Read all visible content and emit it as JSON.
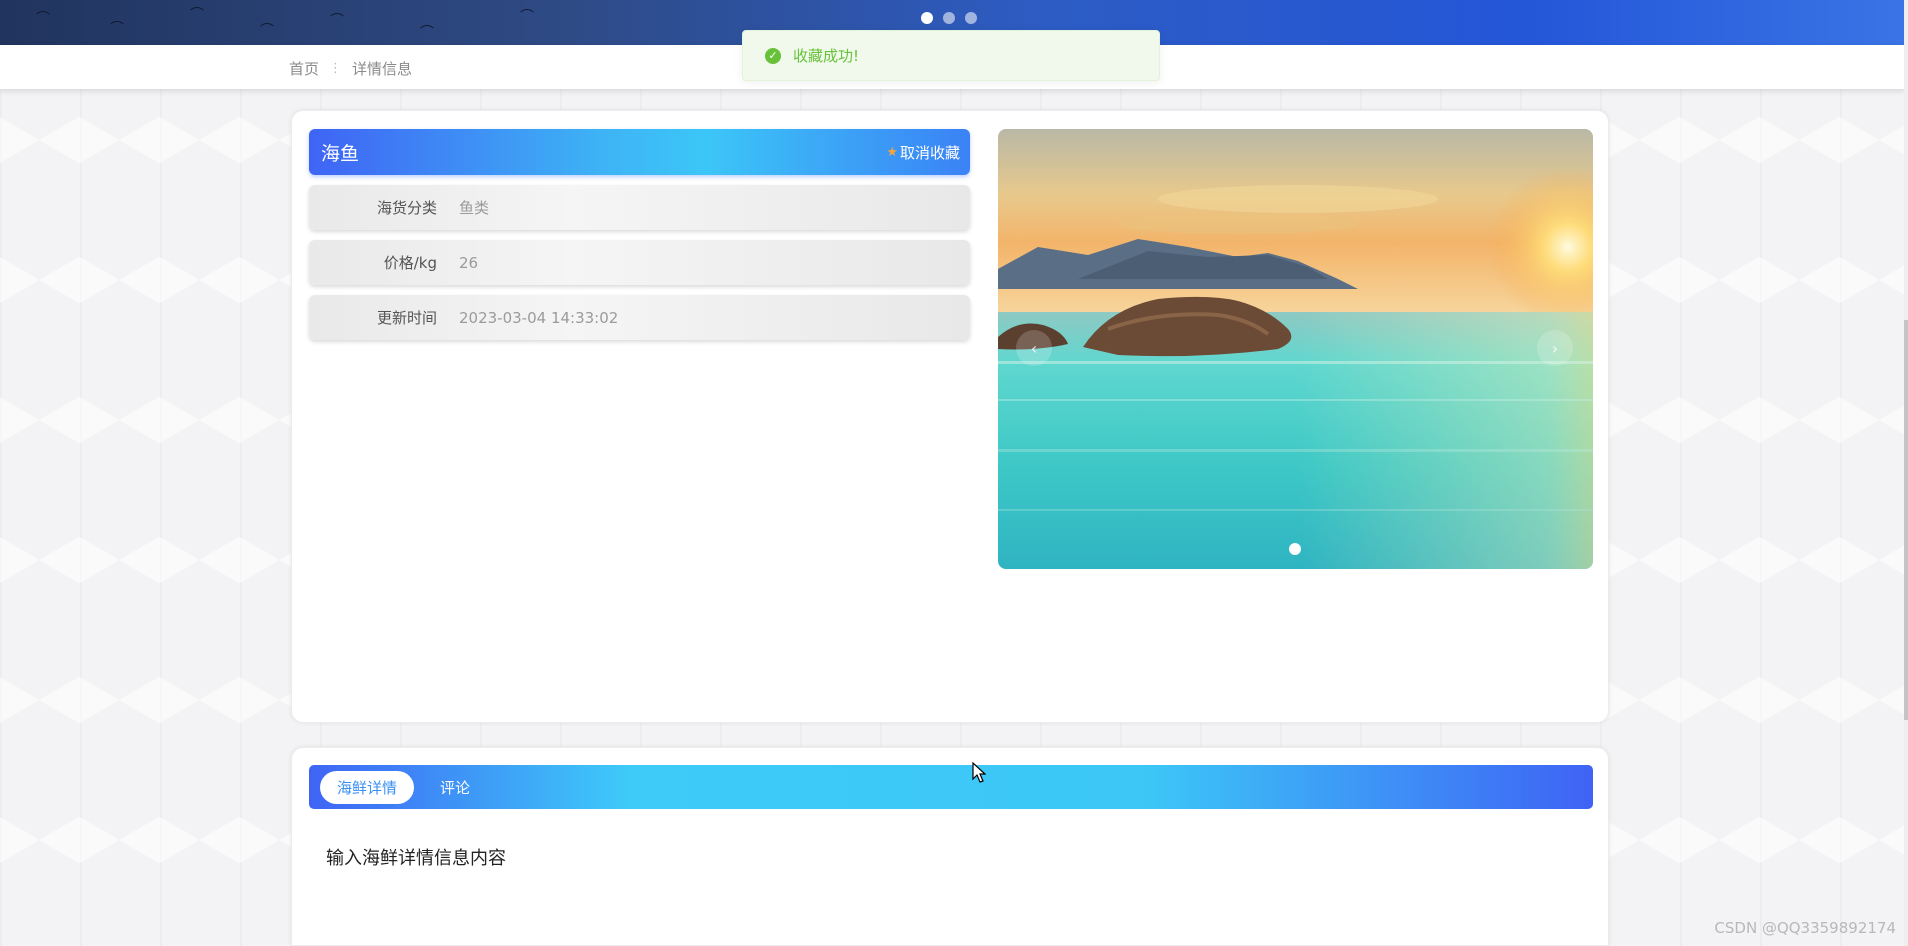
{
  "banner": {
    "slides": 3,
    "active_slide": 0
  },
  "breadcrumb": {
    "home": "首页",
    "separator": "⋮",
    "current": "详情信息"
  },
  "toast": {
    "message": "收藏成功!",
    "icon": "check-circle-icon",
    "color": "#67c23a"
  },
  "product": {
    "name": "海鱼",
    "fav_button": {
      "icon": "star-icon",
      "label": "取消收藏"
    },
    "fields": [
      {
        "label": "海货分类",
        "value": "鱼类"
      },
      {
        "label": "价格/kg",
        "value": "26"
      },
      {
        "label": "更新时间",
        "value": "2023-03-04 14:33:02"
      }
    ]
  },
  "carousel": {
    "image": "sunset-sea-rocks",
    "prev_icon": "‹",
    "next_icon": "›",
    "slides": 1
  },
  "tabs": {
    "items": [
      "海鲜详情",
      "评论"
    ],
    "active": 0
  },
  "detail": {
    "content": "输入海鲜详情信息内容"
  },
  "watermark": "CSDN @QQ3359892174",
  "colors": {
    "accent_blue": "#3f64f5",
    "accent_cyan": "#3cc6f7",
    "star": "#f7a53b"
  }
}
